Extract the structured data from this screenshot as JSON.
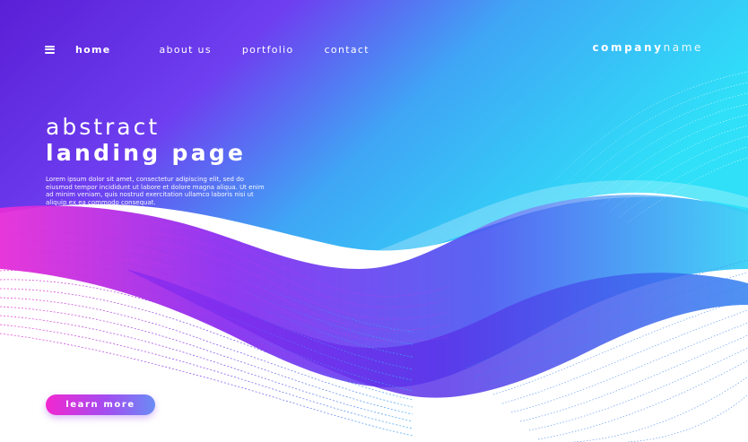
{
  "nav": {
    "items": [
      {
        "label": "home",
        "active": true
      },
      {
        "label": "about us",
        "active": false
      },
      {
        "label": "portfolio",
        "active": false
      },
      {
        "label": "contact",
        "active": false
      }
    ]
  },
  "brand": {
    "bold": "company",
    "light": "name"
  },
  "hero": {
    "line1": "abstract",
    "line2": "landing page",
    "body": "Lorem ipsum dolor sit amet, consectetur adipiscing elit, sed do eiusmod tempor incididunt ut labore et dolore magna aliqua. Ut enim ad minim veniam, quis nostrud exercitation ullamco laboris nisi ut aliquip ex ea commodo consequat."
  },
  "cta": {
    "label": "learn more"
  },
  "colors": {
    "gradient_start": "#5a1fd6",
    "gradient_mid": "#7b3cf0",
    "gradient_end": "#2fd5f7",
    "accent_pink": "#f227d0",
    "text": "#ffffff"
  }
}
